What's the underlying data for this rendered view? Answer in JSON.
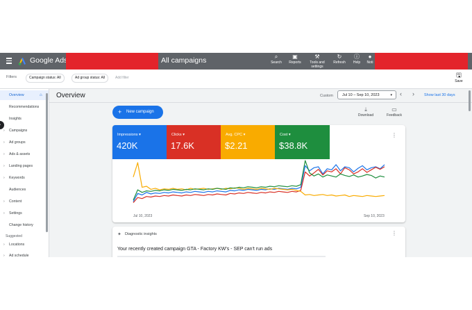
{
  "topbar": {
    "brand": "Google Ads",
    "title": "All campaigns",
    "tools": [
      {
        "label": "Search",
        "icon": "search-icon"
      },
      {
        "label": "Reports",
        "icon": "reports-icon"
      },
      {
        "label": "Tools and",
        "label2": "settings",
        "icon": "wrench-icon"
      },
      {
        "label": "Refresh",
        "icon": "refresh-icon"
      },
      {
        "label": "Help",
        "icon": "help-icon"
      },
      {
        "label": "Noti",
        "icon": "bell-icon"
      }
    ]
  },
  "filters": {
    "label": "Filters",
    "chips": [
      "Campaign status: All",
      "Ad group status: All"
    ],
    "add_filter": "Add filter",
    "save": "Save"
  },
  "sidebar": {
    "items": [
      {
        "label": "Overview",
        "active": true,
        "expandable": false
      },
      {
        "label": "Recommendations",
        "expandable": false
      },
      {
        "label": "Insights",
        "expandable": false
      },
      {
        "label": "Campaigns",
        "expandable": true
      },
      {
        "label": "Ad groups",
        "expandable": true
      },
      {
        "label": "Ads & assets",
        "expandable": true
      },
      {
        "label": "Landing pages",
        "expandable": true
      },
      {
        "label": "Keywords",
        "expandable": true
      },
      {
        "label": "Audiences",
        "expandable": false
      },
      {
        "label": "Content",
        "expandable": true
      },
      {
        "label": "Settings",
        "expandable": true
      },
      {
        "label": "Change history",
        "expandable": false
      }
    ],
    "section": "Suggested",
    "suggested": [
      {
        "label": "Locations",
        "expandable": true
      },
      {
        "label": "Ad schedule",
        "expandable": true
      }
    ]
  },
  "main": {
    "title": "Overview",
    "custom_label": "Custom",
    "date_range": "Jul 10 – Sep 10, 2023",
    "show_last": "Show last 30 days",
    "new_campaign": "New campaign",
    "download": "Download",
    "feedback": "Feedback"
  },
  "metrics": [
    {
      "label": "Impressions",
      "value": "420K",
      "color": "#1a73e8"
    },
    {
      "label": "Clicks",
      "value": "17.6K",
      "color": "#d93025"
    },
    {
      "label": "Avg. CPC",
      "value": "$2.21",
      "color": "#f9ab00"
    },
    {
      "label": "Cost",
      "value": "$38.8K",
      "color": "#1e8e3e"
    }
  ],
  "chart_data": {
    "type": "line",
    "x_start_label": "Jul 10, 2023",
    "x_end_label": "Sep 10, 2023",
    "series": [
      {
        "name": "Impressions",
        "color": "#1a73e8",
        "values": [
          12,
          28,
          25,
          30,
          27,
          29,
          28,
          30,
          29,
          31,
          30,
          29,
          31,
          30,
          32,
          31,
          30,
          32,
          31,
          33,
          32,
          31,
          34,
          33,
          35,
          34,
          36,
          35,
          34,
          36,
          35,
          37,
          36,
          38,
          37,
          36,
          38,
          37,
          40,
          82,
          72,
          78,
          80,
          66,
          76,
          74,
          84,
          72,
          80,
          78,
          70,
          77,
          82,
          74,
          78,
          80,
          76,
          84
        ]
      },
      {
        "name": "Clicks",
        "color": "#d93025",
        "values": [
          10,
          20,
          18,
          22,
          21,
          23,
          22,
          24,
          23,
          25,
          24,
          23,
          25,
          24,
          26,
          25,
          24,
          26,
          25,
          27,
          26,
          25,
          28,
          27,
          29,
          28,
          30,
          29,
          28,
          30,
          29,
          31,
          30,
          32,
          31,
          30,
          32,
          31,
          34,
          70,
          62,
          68,
          75,
          64,
          72,
          70,
          76,
          66,
          78,
          74,
          66,
          70,
          76,
          69,
          74,
          79,
          75,
          80
        ]
      },
      {
        "name": "Avg. CPC",
        "color": "#f9ab00",
        "values": [
          60,
          88,
          40,
          42,
          36,
          38,
          35,
          37,
          36,
          38,
          36,
          37,
          35,
          38,
          36,
          37,
          38,
          36,
          37,
          38,
          36,
          38,
          37,
          39,
          38,
          36,
          38,
          37,
          36,
          38,
          37,
          36,
          38,
          37,
          36,
          35,
          36,
          34,
          32,
          25,
          26,
          24,
          25,
          26,
          24,
          25,
          23,
          24,
          25,
          22,
          24,
          23,
          22,
          24,
          23,
          22,
          23,
          24
        ]
      },
      {
        "name": "Cost",
        "color": "#1e8e3e",
        "values": [
          15,
          35,
          30,
          33,
          32,
          34,
          33,
          35,
          34,
          36,
          35,
          34,
          36,
          35,
          37,
          36,
          35,
          37,
          36,
          38,
          37,
          36,
          39,
          38,
          40,
          39,
          41,
          40,
          39,
          41,
          40,
          42,
          41,
          43,
          42,
          41,
          43,
          42,
          45,
          92,
          68,
          62,
          66,
          60,
          64,
          62,
          60,
          66,
          63,
          61,
          64,
          60,
          62,
          65,
          63,
          58,
          62,
          60
        ]
      }
    ]
  },
  "diagnostics": {
    "label": "Diagnostic insights",
    "message": "Your recently created campaign GTA - Factory KW's - SEP can't run ads"
  }
}
